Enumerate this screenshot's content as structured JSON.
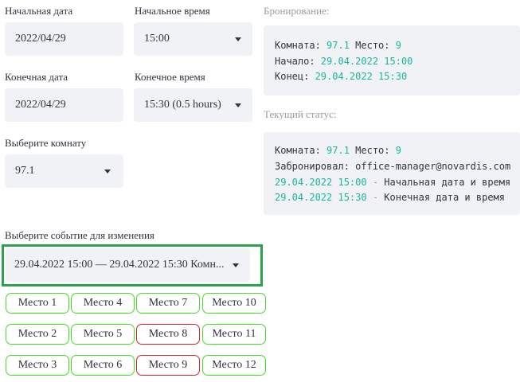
{
  "form": {
    "start_date_label": "Начальная дата",
    "start_date_value": "2022/04/29",
    "start_time_label": "Начальное время",
    "start_time_value": "15:00",
    "end_date_label": "Конечная дата",
    "end_date_value": "2022/04/29",
    "end_time_label": "Конечное время",
    "end_time_value": "15:30 (0.5 hours)",
    "room_label": "Выберите комнату",
    "room_value": "97.1",
    "event_label": "Выберите событие для изменения",
    "event_value": "29.04.2022 15:00 — 29.04.2022 15:30 Комн..."
  },
  "booking": {
    "caption": "Бронирование:",
    "room_key": "Комната: ",
    "room": "97.1",
    "seat_key": " Место: ",
    "seat": "9",
    "start_key": "Начало: ",
    "start": "29.04.2022 15:00",
    "end_key": "Конец: ",
    "end": "29.04.2022 15:30"
  },
  "status": {
    "caption": "Текущий статус:",
    "room_key": "Комната: ",
    "room": "97.1",
    "seat_key": " Место: ",
    "seat": "9",
    "booked_by": "Забронировал: office-manager@novardis.com",
    "start": "29.04.2022 15:00",
    "start_sep": " - ",
    "start_desc": "Начальная дата и время",
    "end": "29.04.2022 15:30",
    "end_sep": " - ",
    "end_desc": "Конечная дата и время"
  },
  "seats": [
    {
      "label": "Место 1",
      "state": "free"
    },
    {
      "label": "Место 2",
      "state": "free"
    },
    {
      "label": "Место 3",
      "state": "free"
    },
    {
      "label": "Место 4",
      "state": "free"
    },
    {
      "label": "Место 5",
      "state": "free"
    },
    {
      "label": "Место 6",
      "state": "free"
    },
    {
      "label": "Место 7",
      "state": "free"
    },
    {
      "label": "Место 8",
      "state": "busy"
    },
    {
      "label": "Место 9",
      "state": "busy"
    },
    {
      "label": "Место 10",
      "state": "free"
    },
    {
      "label": "Место 11",
      "state": "free"
    },
    {
      "label": "Место 12",
      "state": "free"
    }
  ],
  "colors": {
    "free_border": "#44dd27",
    "busy_border": "#d2242c",
    "highlight_frame": "#2aa34a",
    "code_number": "#1bb59c",
    "code_dash": "#ff8a3d"
  }
}
